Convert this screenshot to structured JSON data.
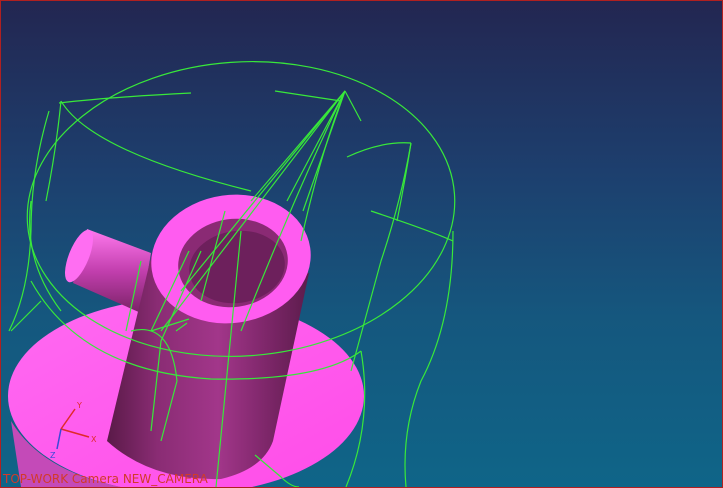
{
  "viewport": {
    "status_text": "TOP-WORK Camera NEW_CAMERA",
    "status_color": "#d23a2a",
    "border_color": "#b02020"
  },
  "triad": {
    "x_label": "X",
    "y_label": "Y",
    "z_label": "Z",
    "x_color": "#e02a2a",
    "y_color": "#e02a2a",
    "z_color": "#3a4ad8"
  },
  "colors": {
    "background_top": "#232651",
    "background_bottom": "#0f6588",
    "part_shaded": "#ff5cf0",
    "part_side": "#9a2f80",
    "wireframe": "#38e83a"
  },
  "scene": {
    "objects": [
      "base-disc",
      "main-tube",
      "side-boss",
      "wireframe-cylinder",
      "wireframe-cone"
    ]
  }
}
